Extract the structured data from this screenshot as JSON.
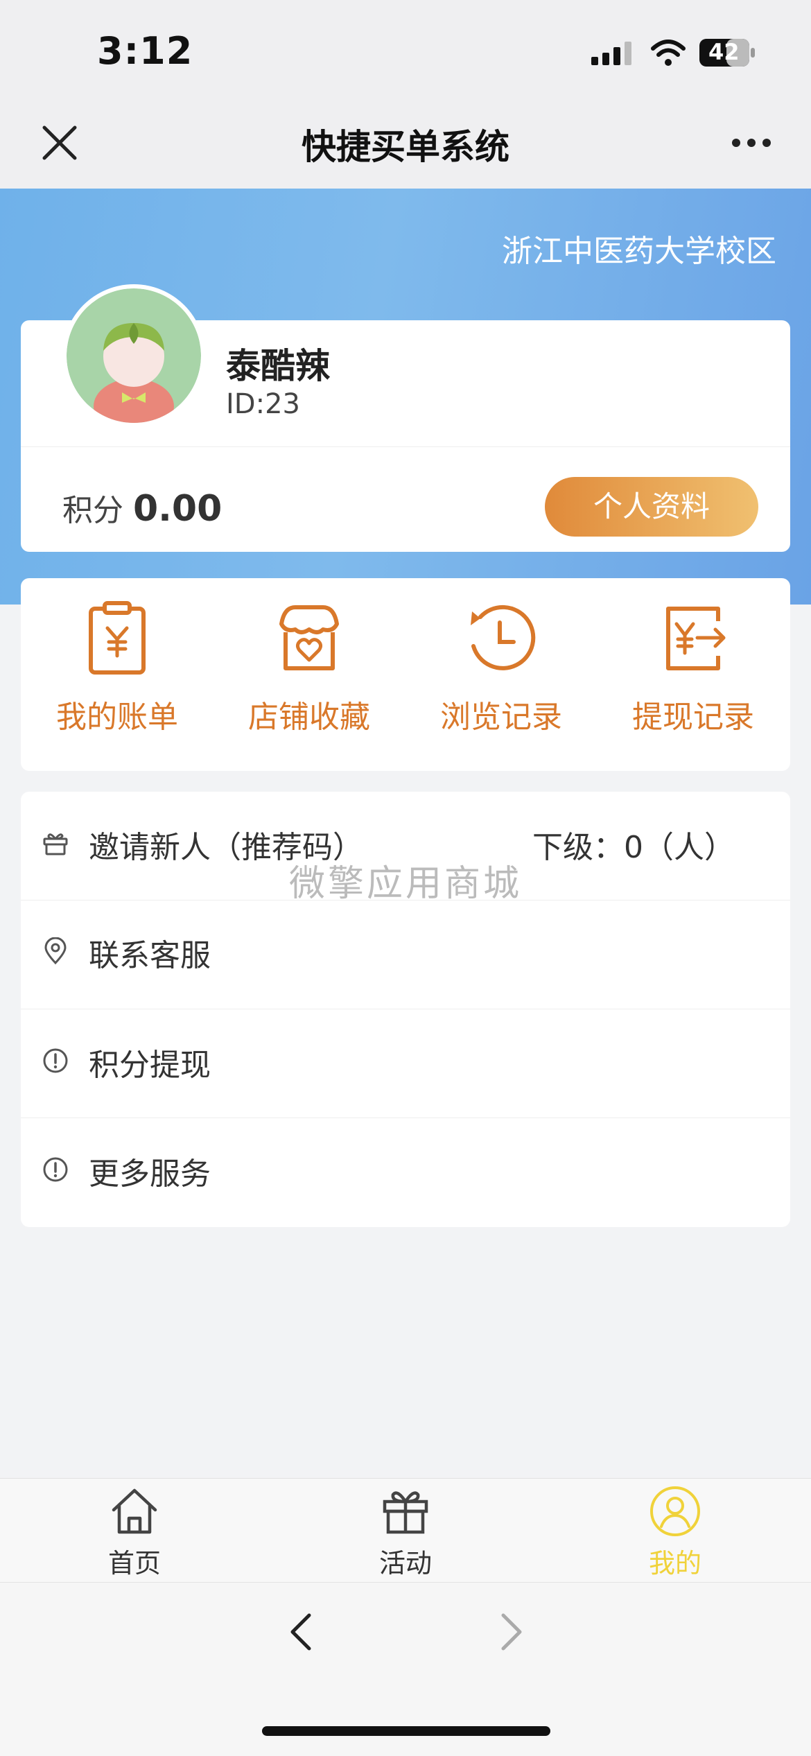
{
  "status_bar": {
    "time": "3:12",
    "battery": "42"
  },
  "nav": {
    "title": "快捷买单系统"
  },
  "header": {
    "campus": "浙江中医药大学校区"
  },
  "profile": {
    "name": "泰酷辣",
    "id": "ID:23",
    "points_label": "积分",
    "points_value": "0.00",
    "profile_button": "个人资料"
  },
  "quick_menu": [
    {
      "label": "我的账单",
      "icon": "bill-icon"
    },
    {
      "label": "店铺收藏",
      "icon": "store-favorite-icon"
    },
    {
      "label": "浏览记录",
      "icon": "history-icon"
    },
    {
      "label": "提现记录",
      "icon": "withdraw-record-icon"
    }
  ],
  "list": {
    "invite": {
      "label": "邀请新人（推荐码）",
      "subordinate": "下级：0（人）",
      "icon": "gift-icon"
    },
    "service": {
      "label": "联系客服",
      "icon": "location-pin-icon"
    },
    "withdraw": {
      "label": "积分提现",
      "icon": "alert-circle-icon"
    },
    "more": {
      "label": "更多服务",
      "icon": "alert-circle-icon"
    }
  },
  "watermark": "微擎应用商城",
  "tabs": [
    {
      "label": "首页",
      "icon": "home-icon",
      "active": false
    },
    {
      "label": "活动",
      "icon": "gift-icon",
      "active": false
    },
    {
      "label": "我的",
      "icon": "user-icon",
      "active": true
    }
  ],
  "colors": {
    "accent_orange": "#d9782a",
    "tab_active": "#f0d23a",
    "header_blue": "#6fb1ea"
  }
}
